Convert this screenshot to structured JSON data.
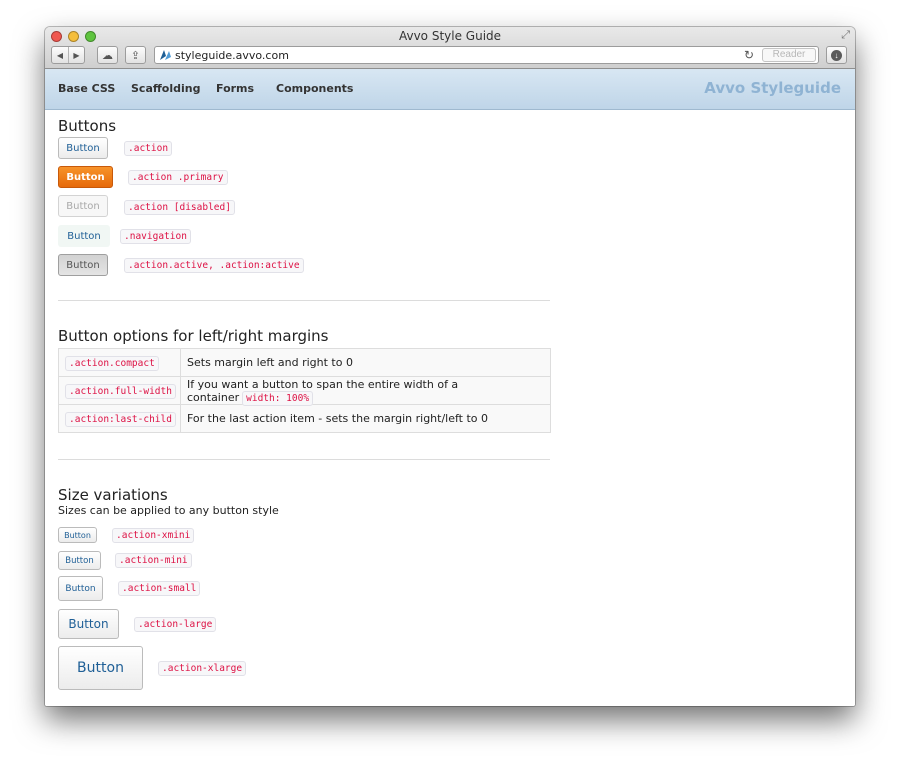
{
  "window": {
    "title": "Avvo Style Guide"
  },
  "toolbar": {
    "back_glyph": "◀",
    "forward_glyph": "▶",
    "cloud_glyph": "☁",
    "share_glyph": "⇪",
    "url": "styleguide.avvo.com",
    "reload_glyph": "↻",
    "reader_label": "Reader",
    "download_glyph": "↓",
    "fullscreen_glyph": "⤢"
  },
  "nav": {
    "items": [
      {
        "label": "Base CSS"
      },
      {
        "label": "Scaffolding"
      },
      {
        "label": "Forms"
      },
      {
        "label": "Components"
      }
    ],
    "brand": "Avvo Styleguide",
    "brand_color": "#8fb3d3"
  },
  "buttons_section": {
    "title": "Buttons",
    "rows": [
      {
        "button": "Button",
        "code": ".action"
      },
      {
        "button": "Button",
        "code": ".action .primary"
      },
      {
        "button": "Button",
        "code": ".action [disabled]"
      },
      {
        "button": "Button",
        "code": ".navigation"
      },
      {
        "button": "Button",
        "code": ".action.active, .action:active"
      }
    ]
  },
  "options_section": {
    "title": "Button options for left/right margins",
    "rows": [
      {
        "code": ".action.compact",
        "desc": "Sets margin left and right to 0",
        "extra_code": ""
      },
      {
        "code": ".action.full-width",
        "desc": "If you want a button to span the entire width of a container",
        "extra_code": "width: 100%"
      },
      {
        "code": ".action:last-child",
        "desc": "For the last action item - sets the margin right/left to 0",
        "extra_code": ""
      }
    ]
  },
  "sizes_section": {
    "title": "Size variations",
    "subtitle": "Sizes can be applied to any button style",
    "rows": [
      {
        "button": "Button",
        "code": ".action-xmini"
      },
      {
        "button": "Button",
        "code": ".action-mini"
      },
      {
        "button": "Button",
        "code": ".action-small"
      },
      {
        "button": "Button",
        "code": ".action-large"
      },
      {
        "button": "Button",
        "code": ".action-xlarge"
      }
    ]
  },
  "colors": {
    "primary": "#f08020",
    "link": "#1f5f96",
    "code": "#dd1144",
    "navbar": "#c9dcec"
  }
}
